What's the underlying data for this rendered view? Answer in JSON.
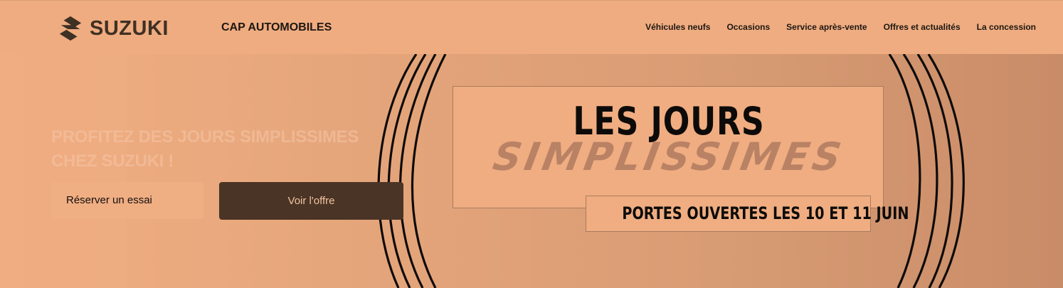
{
  "header": {
    "brand_name": "SUZUKI",
    "dealer_name": "CAP AUTOMOBILES",
    "nav": [
      {
        "label": "Véhicules neufs"
      },
      {
        "label": "Occasions"
      },
      {
        "label": "Service après-vente"
      },
      {
        "label": "Offres et actualités"
      },
      {
        "label": "La concession"
      }
    ]
  },
  "hero": {
    "headline": "PROFITEZ DES JOURS SIMPLISSIMES CHEZ SUZUKI !",
    "secondary_button": "Réserver un essai",
    "primary_button": "Voir l'offre"
  },
  "banner": {
    "title": "LES JOURS",
    "script": "SIMPLISSIMES",
    "dates": "PORTES OUVERTES LES 10 ET 11 JUIN"
  },
  "colors": {
    "background": "#efac80",
    "primary_button": "#4a3426",
    "text_dark": "#1d1712",
    "logo": "#3f3024"
  },
  "icons": {
    "logo": "suzuki-s-logo-icon"
  }
}
